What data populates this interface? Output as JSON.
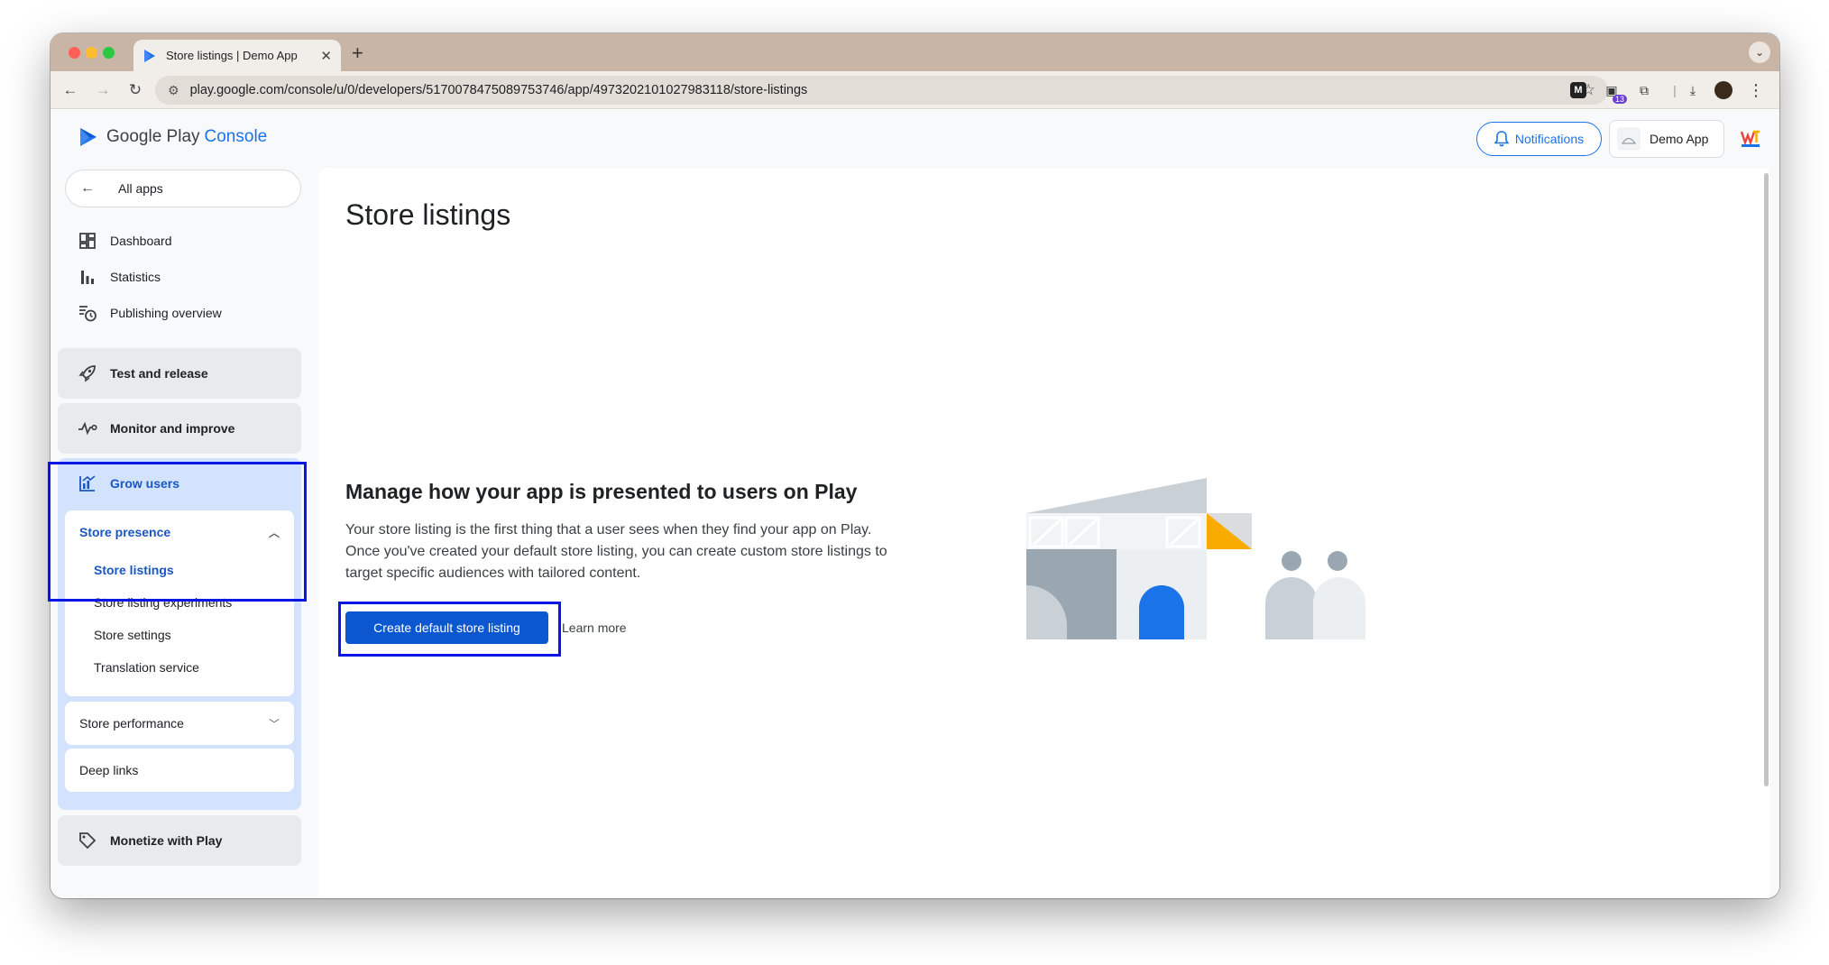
{
  "browser": {
    "tab_title": "Store listings | Demo App",
    "url": "play.google.com/console/u/0/developers/5170078475089753746/app/4973202101027983118/store-listings",
    "extension_badge": "13"
  },
  "header": {
    "logo_text": "Google Play",
    "logo_accent": "Console",
    "notifications_label": "Notifications",
    "app_name": "Demo App"
  },
  "sidebar": {
    "all_apps": "All apps",
    "links": {
      "dashboard": "Dashboard",
      "statistics": "Statistics",
      "publishing_overview": "Publishing overview"
    },
    "sections": {
      "test_release": "Test and release",
      "monitor": "Monitor and improve",
      "grow": "Grow users",
      "monetize": "Monetize with Play"
    },
    "store_presence": {
      "label": "Store presence",
      "items": [
        "Store listings",
        "Store listing experiments",
        "Store settings",
        "Translation service"
      ]
    },
    "store_performance": "Store performance",
    "deep_links": "Deep links"
  },
  "main": {
    "title": "Store listings",
    "heading": "Manage how your app is presented to users on Play",
    "description": "Your store listing is the first thing that a user sees when they find your app on Play. Once you've created your default store listing, you can create custom store listings to target specific audiences with tailored content.",
    "cta": "Create default store listing",
    "learn_more": "Learn more"
  },
  "colors": {
    "accent": "#0b57d0",
    "highlight": "#0a16e6",
    "grow_section": "#d3e3fd",
    "illustration_yellow": "#f9ab00"
  }
}
